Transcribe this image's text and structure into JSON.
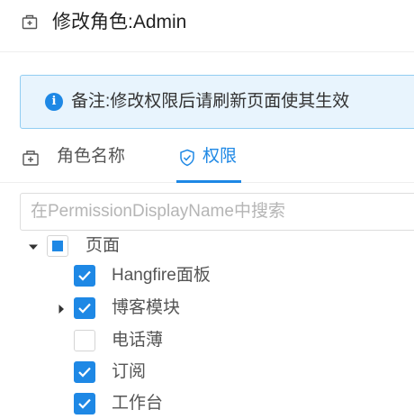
{
  "header": {
    "icon": "role-icon",
    "title": "修改角色:Admin"
  },
  "notice": {
    "icon": "info-icon",
    "icon_glyph": "i",
    "text": "备注:修改权限后请刷新页面使其生效",
    "background": "#e8f4fd",
    "border": "#91cdf2"
  },
  "tabs": [
    {
      "icon": "role-icon",
      "label": "角色名称",
      "active": false
    },
    {
      "icon": "shield-check-icon",
      "label": "权限",
      "active": true
    }
  ],
  "search": {
    "value": "",
    "placeholder": "在PermissionDisplayName中搜索"
  },
  "tree": {
    "root": {
      "label": "页面",
      "state": "indeterminate",
      "expanded": true
    },
    "children": [
      {
        "label": "Hangfire面板",
        "checked": true,
        "has_children": false
      },
      {
        "label": "博客模块",
        "checked": true,
        "has_children": true,
        "expanded": false
      },
      {
        "label": "电话薄",
        "checked": false,
        "has_children": false
      },
      {
        "label": "订阅",
        "checked": true,
        "has_children": false
      },
      {
        "label": "工作台",
        "checked": true,
        "has_children": false
      }
    ]
  },
  "colors": {
    "accent": "#1e88e5",
    "text": "#333333",
    "muted_text": "#555555",
    "placeholder": "#b5b5b5"
  }
}
